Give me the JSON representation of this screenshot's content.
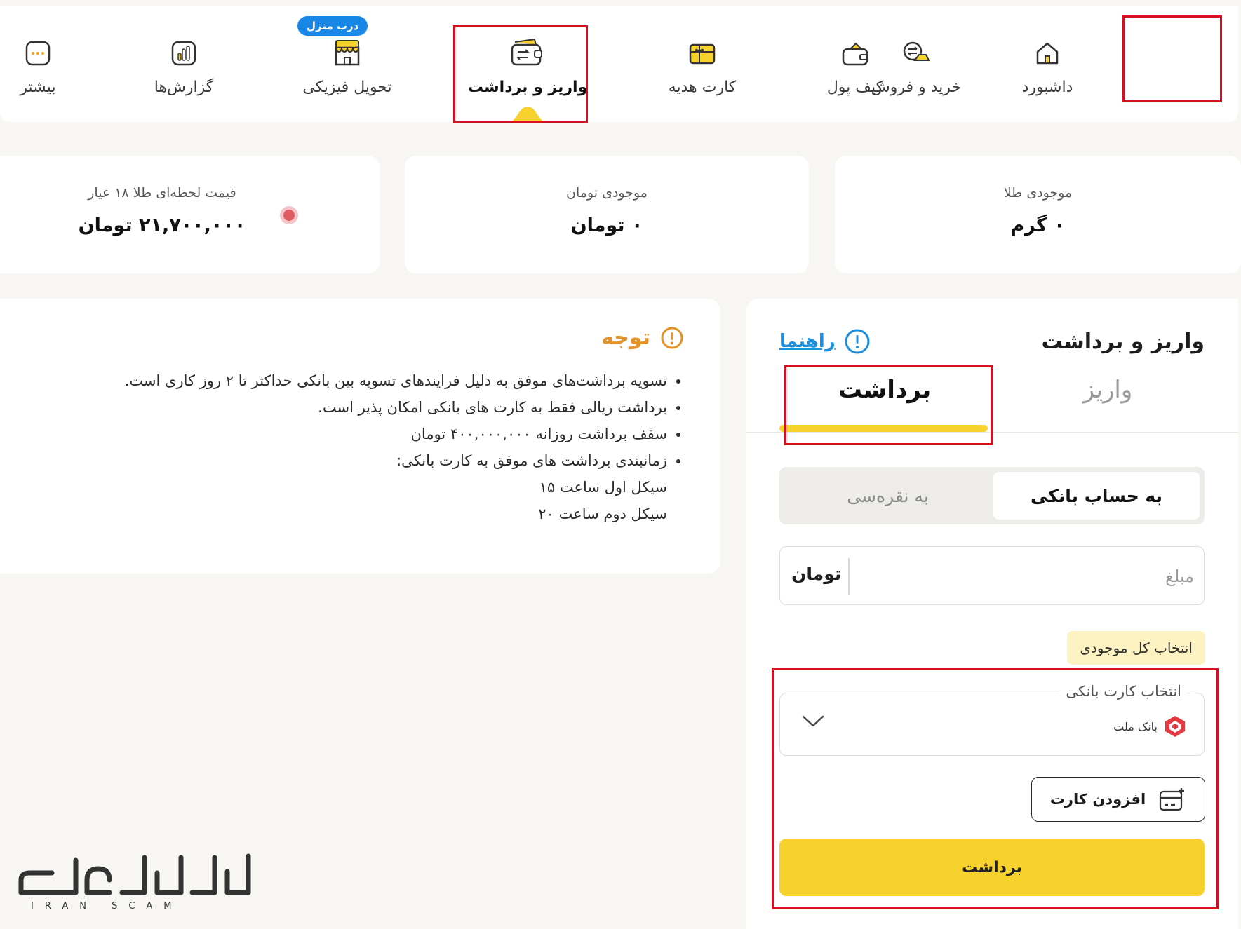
{
  "nav": {
    "items": [
      {
        "label": "داشبورد",
        "icon": "home-icon"
      },
      {
        "label": "خرید و فروش",
        "icon": "exchange-icon"
      },
      {
        "label": "کیف پول",
        "icon": "wallet-icon"
      },
      {
        "label": "کارت هدیه",
        "icon": "gift-card-icon"
      },
      {
        "label": "واریز و برداشت",
        "icon": "deposit-withdraw-icon"
      },
      {
        "label": "تحویل فیزیکی",
        "icon": "store-icon"
      },
      {
        "label": "گزارش‌ها",
        "icon": "report-icon"
      },
      {
        "label": "بیشتر",
        "icon": "more-icon"
      }
    ],
    "active_index": 4,
    "badge": "درب منزل"
  },
  "stats": {
    "gold_balance_label": "موجودی طلا",
    "gold_balance_value": "۰ گرم",
    "toman_balance_label": "موجودی تومان",
    "toman_balance_value": "۰ تومان",
    "live_price_label": "قیمت لحظه‌ای طلا ۱۸ عیار",
    "live_price_value": "۲۱,۷۰۰,۰۰۰ تومان"
  },
  "notice": {
    "title": "توجه",
    "items": [
      "تسویه برداشت‌های موفق به دلیل فرایندهای تسویه بین بانکی حداکثر تا ۲ روز کاری است.",
      "برداشت ریالی فقط به کارت های بانکی امکان پذیر است.",
      "سقف برداشت روزانه ۴۰۰,۰۰۰,۰۰۰ تومان",
      "زمانبندی برداشت های موفق به کارت بانکی:"
    ],
    "cycles": [
      "سیکل اول ساعت ۱۵",
      "سیکل دوم ساعت ۲۰"
    ]
  },
  "withdraw": {
    "title": "واریز و برداشت",
    "help_label": "راهنما",
    "tabs": [
      "واریز",
      "برداشت"
    ],
    "active_tab": "برداشت",
    "destination": {
      "selected": "به حساب بانکی",
      "other": "به نقره‌سی"
    },
    "amount_placeholder": "مبلغ",
    "amount_unit": "تومان",
    "select_all_label": "انتخاب کل موجودی",
    "card_select_label": "انتخاب کارت بانکی",
    "selected_bank": "بانک ملت",
    "add_card_label": "افزودن کارت",
    "submit_label": "برداشت"
  },
  "watermark": {
    "text": "ایران اسکم",
    "subtext": "IRAN SCAM"
  },
  "colors": {
    "accent": "#f8d22c",
    "highlight_box": "#d7101f",
    "notice": "#e4922a",
    "link": "#1a8fe0",
    "live_dot": "#e05a62"
  }
}
